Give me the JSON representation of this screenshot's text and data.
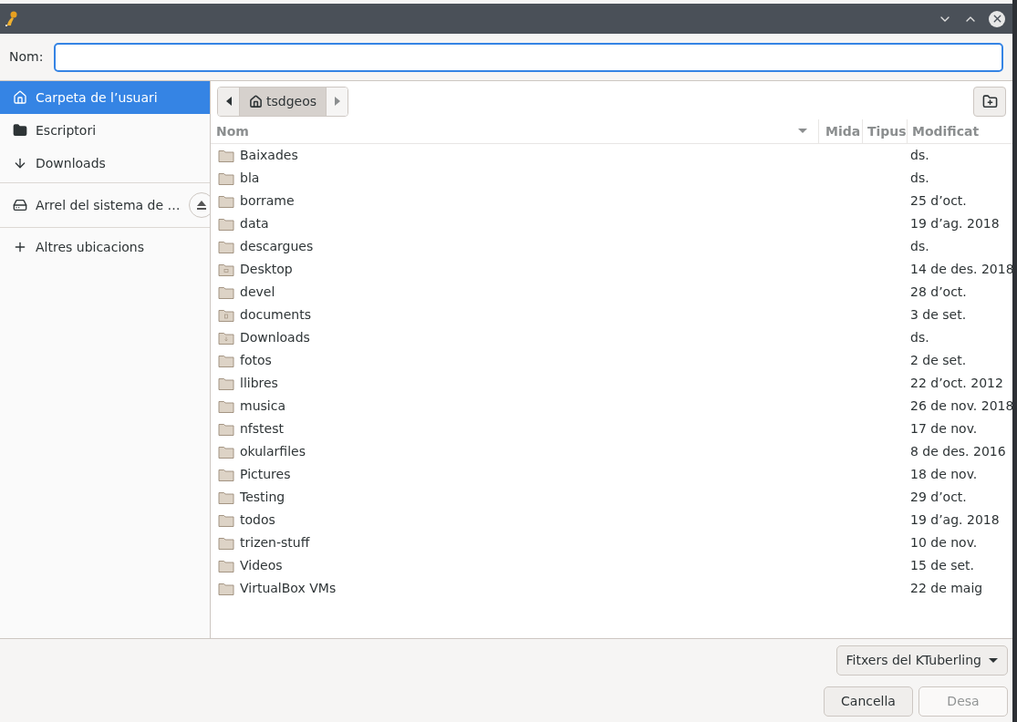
{
  "name_field": {
    "label": "Nom:"
  },
  "sidebar": {
    "items": [
      {
        "label": "Carpeta de l’usuari",
        "kind": "place",
        "selected": true
      },
      {
        "label": "Escriptori",
        "kind": "place",
        "selected": false
      },
      {
        "label": "Downloads",
        "kind": "place",
        "selected": false
      },
      {
        "label": "Arrel del sistema de …",
        "kind": "mount",
        "selected": false
      },
      {
        "label": "Altres ubicacions",
        "kind": "place",
        "selected": false
      }
    ]
  },
  "path_bar": {
    "segments": [
      {
        "label": "tsdgeos",
        "selected": true
      }
    ]
  },
  "table": {
    "columns": [
      "Nom",
      "Mida",
      "Tipus",
      "Modificat"
    ],
    "rows": [
      {
        "name": "Baixades",
        "kind": "folder",
        "modified": "ds."
      },
      {
        "name": "bla",
        "kind": "folder",
        "modified": "ds."
      },
      {
        "name": "borrame",
        "kind": "folder",
        "modified": "25 d’oct."
      },
      {
        "name": "data",
        "kind": "folder",
        "modified": "19 d’ag. 2018"
      },
      {
        "name": "descargues",
        "kind": "folder",
        "modified": "ds."
      },
      {
        "name": "Desktop",
        "kind": "desktop",
        "modified": "14 de des. 2018"
      },
      {
        "name": "devel",
        "kind": "folder",
        "modified": "28 d’oct."
      },
      {
        "name": "documents",
        "kind": "documents",
        "modified": "3 de set."
      },
      {
        "name": "Downloads",
        "kind": "downloads",
        "modified": "ds."
      },
      {
        "name": "fotos",
        "kind": "folder",
        "modified": "2 de set."
      },
      {
        "name": "llibres",
        "kind": "folder",
        "modified": "22 d’oct. 2012"
      },
      {
        "name": "musica",
        "kind": "folder",
        "modified": "26 de nov. 2018"
      },
      {
        "name": "nfstest",
        "kind": "folder",
        "modified": "17 de nov."
      },
      {
        "name": "okularfiles",
        "kind": "folder",
        "modified": "8 de des. 2016"
      },
      {
        "name": "Pictures",
        "kind": "folder",
        "modified": "18 de nov."
      },
      {
        "name": "Testing",
        "kind": "folder",
        "modified": "29 d’oct."
      },
      {
        "name": "todos",
        "kind": "folder",
        "modified": "19 d’ag. 2018"
      },
      {
        "name": "trizen-stuff",
        "kind": "folder",
        "modified": "10 de nov."
      },
      {
        "name": "Videos",
        "kind": "folder",
        "modified": "15 de set."
      },
      {
        "name": "VirtualBox VMs",
        "kind": "folder",
        "modified": "22 de maig"
      }
    ]
  },
  "filter": {
    "label": "Fitxers del KTuberling"
  },
  "buttons": [
    {
      "label": "Cancella",
      "disabled": false
    },
    {
      "label": "Desa",
      "disabled": true
    }
  ]
}
